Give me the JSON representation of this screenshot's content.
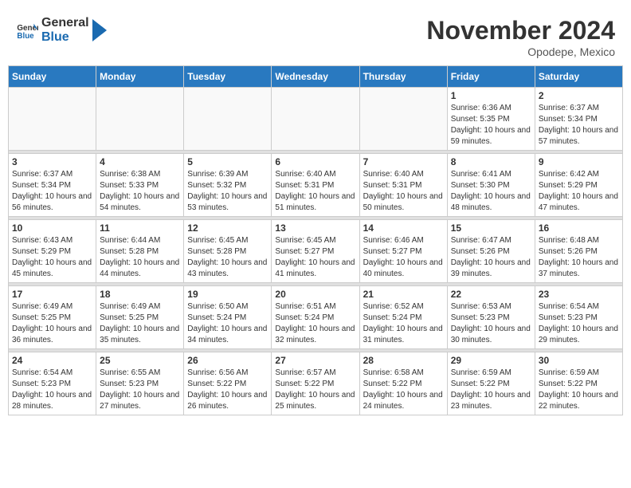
{
  "header": {
    "logo_line1": "General",
    "logo_line2": "Blue",
    "month_title": "November 2024",
    "location": "Opodepe, Mexico"
  },
  "weekdays": [
    "Sunday",
    "Monday",
    "Tuesday",
    "Wednesday",
    "Thursday",
    "Friday",
    "Saturday"
  ],
  "weeks": [
    [
      {
        "day": "",
        "info": ""
      },
      {
        "day": "",
        "info": ""
      },
      {
        "day": "",
        "info": ""
      },
      {
        "day": "",
        "info": ""
      },
      {
        "day": "",
        "info": ""
      },
      {
        "day": "1",
        "info": "Sunrise: 6:36 AM\nSunset: 5:35 PM\nDaylight: 10 hours and 59 minutes."
      },
      {
        "day": "2",
        "info": "Sunrise: 6:37 AM\nSunset: 5:34 PM\nDaylight: 10 hours and 57 minutes."
      }
    ],
    [
      {
        "day": "3",
        "info": "Sunrise: 6:37 AM\nSunset: 5:34 PM\nDaylight: 10 hours and 56 minutes."
      },
      {
        "day": "4",
        "info": "Sunrise: 6:38 AM\nSunset: 5:33 PM\nDaylight: 10 hours and 54 minutes."
      },
      {
        "day": "5",
        "info": "Sunrise: 6:39 AM\nSunset: 5:32 PM\nDaylight: 10 hours and 53 minutes."
      },
      {
        "day": "6",
        "info": "Sunrise: 6:40 AM\nSunset: 5:31 PM\nDaylight: 10 hours and 51 minutes."
      },
      {
        "day": "7",
        "info": "Sunrise: 6:40 AM\nSunset: 5:31 PM\nDaylight: 10 hours and 50 minutes."
      },
      {
        "day": "8",
        "info": "Sunrise: 6:41 AM\nSunset: 5:30 PM\nDaylight: 10 hours and 48 minutes."
      },
      {
        "day": "9",
        "info": "Sunrise: 6:42 AM\nSunset: 5:29 PM\nDaylight: 10 hours and 47 minutes."
      }
    ],
    [
      {
        "day": "10",
        "info": "Sunrise: 6:43 AM\nSunset: 5:29 PM\nDaylight: 10 hours and 45 minutes."
      },
      {
        "day": "11",
        "info": "Sunrise: 6:44 AM\nSunset: 5:28 PM\nDaylight: 10 hours and 44 minutes."
      },
      {
        "day": "12",
        "info": "Sunrise: 6:45 AM\nSunset: 5:28 PM\nDaylight: 10 hours and 43 minutes."
      },
      {
        "day": "13",
        "info": "Sunrise: 6:45 AM\nSunset: 5:27 PM\nDaylight: 10 hours and 41 minutes."
      },
      {
        "day": "14",
        "info": "Sunrise: 6:46 AM\nSunset: 5:27 PM\nDaylight: 10 hours and 40 minutes."
      },
      {
        "day": "15",
        "info": "Sunrise: 6:47 AM\nSunset: 5:26 PM\nDaylight: 10 hours and 39 minutes."
      },
      {
        "day": "16",
        "info": "Sunrise: 6:48 AM\nSunset: 5:26 PM\nDaylight: 10 hours and 37 minutes."
      }
    ],
    [
      {
        "day": "17",
        "info": "Sunrise: 6:49 AM\nSunset: 5:25 PM\nDaylight: 10 hours and 36 minutes."
      },
      {
        "day": "18",
        "info": "Sunrise: 6:49 AM\nSunset: 5:25 PM\nDaylight: 10 hours and 35 minutes."
      },
      {
        "day": "19",
        "info": "Sunrise: 6:50 AM\nSunset: 5:24 PM\nDaylight: 10 hours and 34 minutes."
      },
      {
        "day": "20",
        "info": "Sunrise: 6:51 AM\nSunset: 5:24 PM\nDaylight: 10 hours and 32 minutes."
      },
      {
        "day": "21",
        "info": "Sunrise: 6:52 AM\nSunset: 5:24 PM\nDaylight: 10 hours and 31 minutes."
      },
      {
        "day": "22",
        "info": "Sunrise: 6:53 AM\nSunset: 5:23 PM\nDaylight: 10 hours and 30 minutes."
      },
      {
        "day": "23",
        "info": "Sunrise: 6:54 AM\nSunset: 5:23 PM\nDaylight: 10 hours and 29 minutes."
      }
    ],
    [
      {
        "day": "24",
        "info": "Sunrise: 6:54 AM\nSunset: 5:23 PM\nDaylight: 10 hours and 28 minutes."
      },
      {
        "day": "25",
        "info": "Sunrise: 6:55 AM\nSunset: 5:23 PM\nDaylight: 10 hours and 27 minutes."
      },
      {
        "day": "26",
        "info": "Sunrise: 6:56 AM\nSunset: 5:22 PM\nDaylight: 10 hours and 26 minutes."
      },
      {
        "day": "27",
        "info": "Sunrise: 6:57 AM\nSunset: 5:22 PM\nDaylight: 10 hours and 25 minutes."
      },
      {
        "day": "28",
        "info": "Sunrise: 6:58 AM\nSunset: 5:22 PM\nDaylight: 10 hours and 24 minutes."
      },
      {
        "day": "29",
        "info": "Sunrise: 6:59 AM\nSunset: 5:22 PM\nDaylight: 10 hours and 23 minutes."
      },
      {
        "day": "30",
        "info": "Sunrise: 6:59 AM\nSunset: 5:22 PM\nDaylight: 10 hours and 22 minutes."
      }
    ]
  ]
}
